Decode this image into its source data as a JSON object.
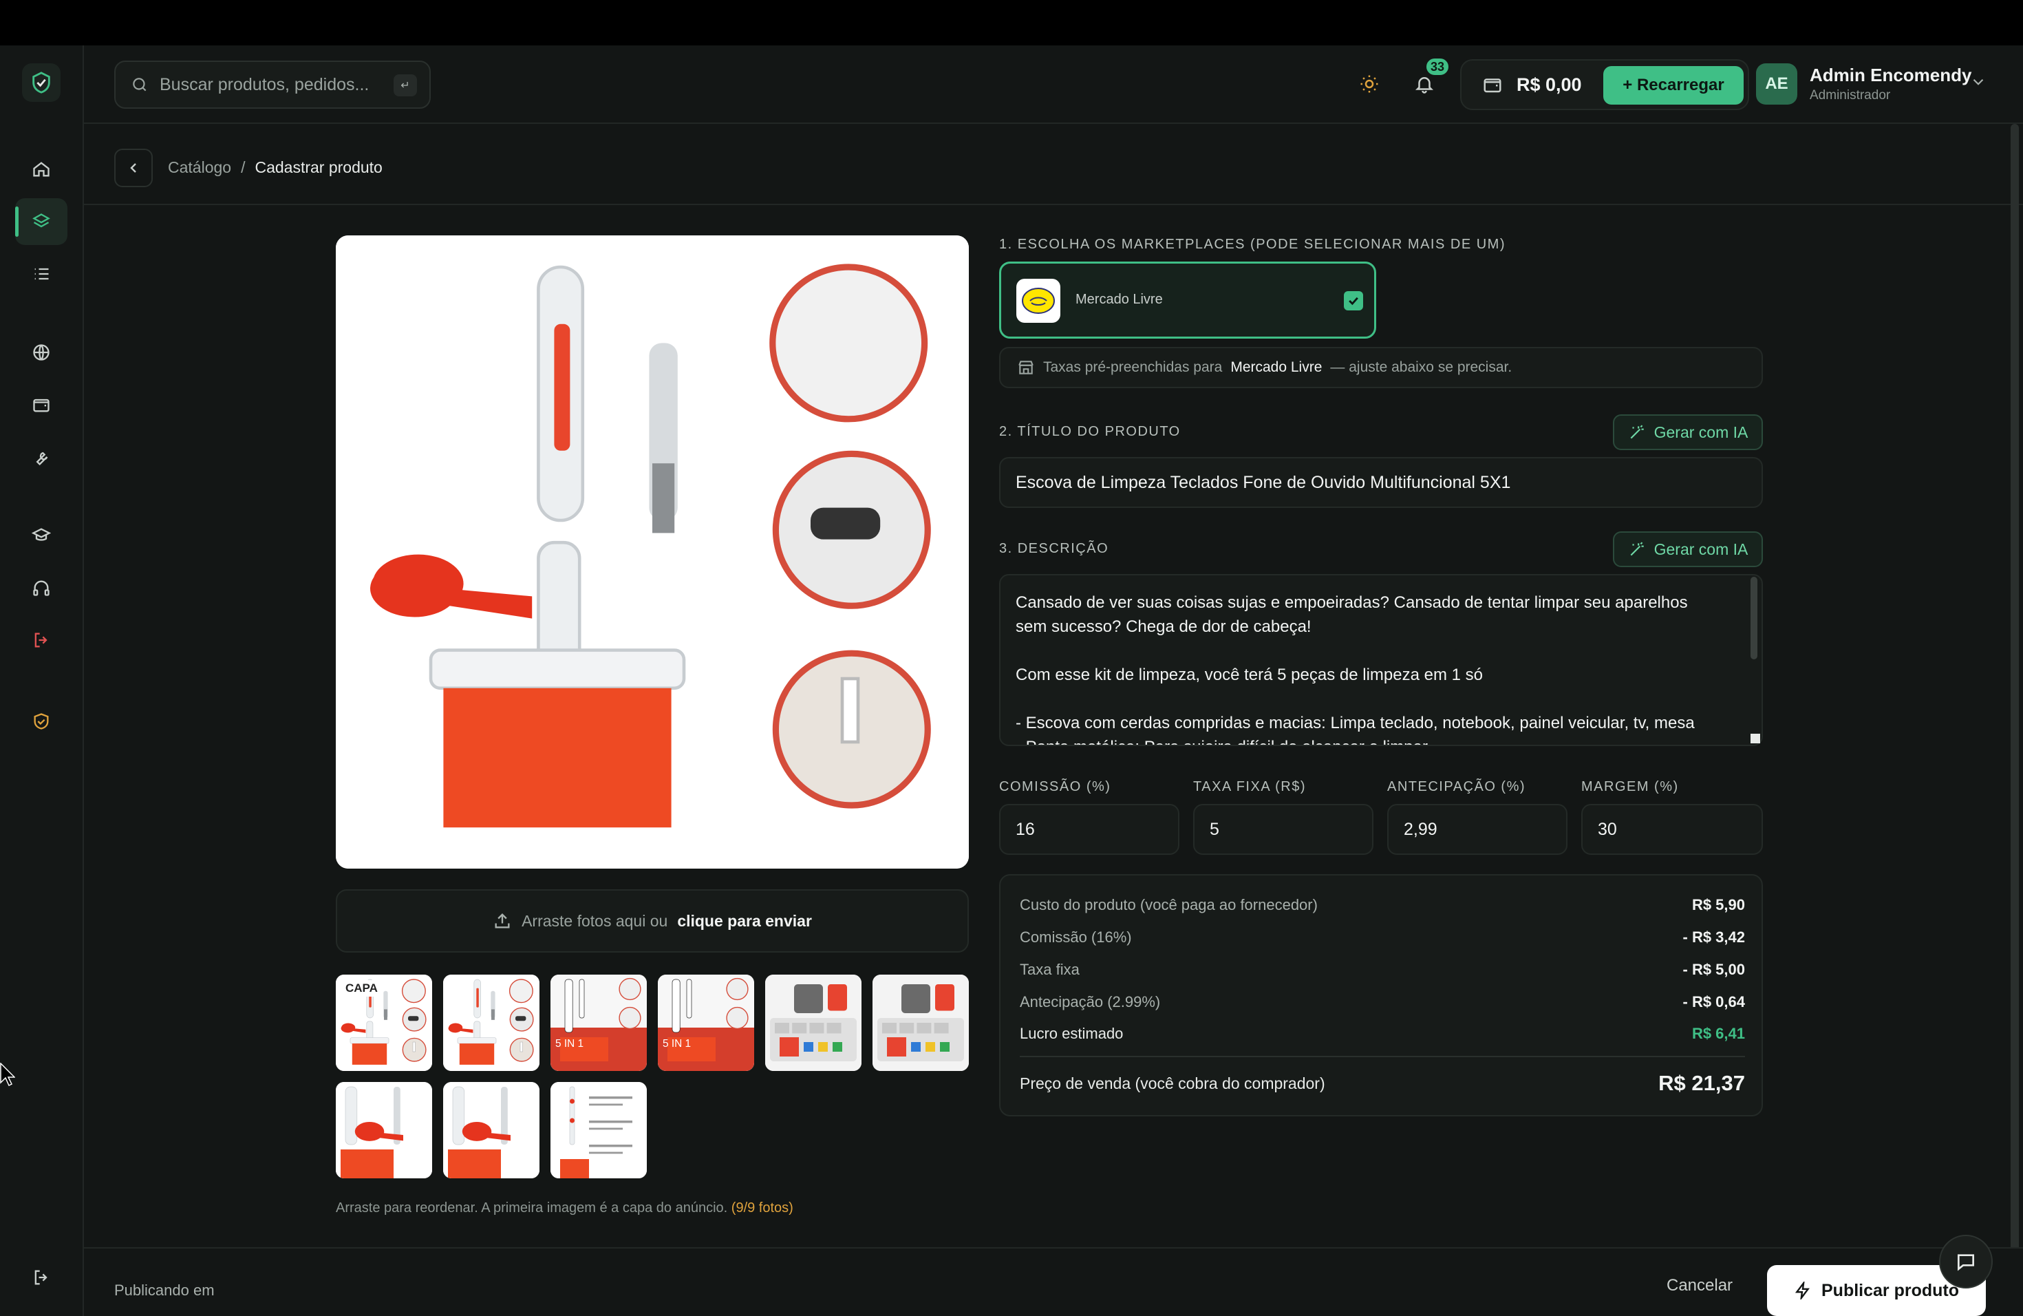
{
  "header": {
    "search_placeholder": "Buscar produtos, pedidos...",
    "search_shortcut": "↵",
    "notifications_count": "33",
    "balance": "R$ 0,00",
    "recharge_label": "Recarregar",
    "user": {
      "initials": "AE",
      "name": "Admin Encomendy",
      "role": "Administrador"
    }
  },
  "sidebar": {
    "items": [
      "home-icon",
      "layers-icon",
      "list-icon",
      "globe-icon",
      "wallet-icon",
      "wrench-icon",
      "graduation-cap-icon",
      "headphones-icon",
      "logout-icon",
      "shield-check-icon"
    ],
    "active": "layers-icon"
  },
  "breadcrumb": {
    "parent": "Catálogo",
    "separator": "/",
    "current": "Cadastrar produto"
  },
  "upload": {
    "dropzone_text": "Arraste fotos aqui ou",
    "dropzone_link": "clique para enviar",
    "cover_badge": "CAPA",
    "hint": "Arraste para reordenar. A primeira imagem é a capa do anúncio.",
    "count": "(9/9 fotos)"
  },
  "form": {
    "marketplaces_label": "1. ESCOLHA OS MARKETPLACES (PODE SELECIONAR MAIS DE UM)",
    "marketplace": {
      "name": "Mercado Livre",
      "selected": true
    },
    "fees_info": {
      "prefix": "Taxas pré-preenchidas para",
      "marketplace": "Mercado Livre",
      "suffix": "— ajuste abaixo se precisar."
    },
    "title_label": "2. TÍTULO DO PRODUTO",
    "ai_button": "Gerar com IA",
    "title_value": "Escova de Limpeza Teclados Fone de Ouvido Multifuncional 5X1",
    "description_label": "3. DESCRIÇÃO",
    "description_value": "Cansado de ver suas coisas sujas e empoeiradas? Cansado de tentar limpar seu aparelhos sem sucesso? Chega de dor de cabeça!\n\nCom esse kit de limpeza, você terá 5 peças de limpeza em 1 só\n\n- Escova com cerdas compridas e macias: Limpa teclado, notebook, painel veicular, tv, mesa\n- Ponta metálica: Para sujeira difícil de alcançar e limpar",
    "fees": {
      "commission_label": "COMISSÃO (%)",
      "commission_value": "16",
      "fixed_label": "TAXA FIXA (R$)",
      "fixed_value": "5",
      "advance_label": "ANTECIPAÇÃO (%)",
      "advance_value": "2,99",
      "margin_label": "MARGEM (%)",
      "margin_value": "30"
    }
  },
  "summary": {
    "rows": [
      {
        "label": "Custo do produto (você paga ao fornecedor)",
        "value": "R$ 5,90"
      },
      {
        "label": "Comissão (16%)",
        "value": "- R$ 3,42"
      },
      {
        "label": "Taxa fixa",
        "value": "- R$ 5,00"
      },
      {
        "label": "Antecipação (2.99%)",
        "value": "- R$ 0,64"
      },
      {
        "label": "Lucro estimado",
        "value": "R$ 6,41"
      }
    ],
    "price_label": "Preço de venda (você cobra do comprador)",
    "price_value": "R$ 21,37"
  },
  "footer": {
    "publishing_in": "Publicando em",
    "cancel_label": "Cancelar",
    "publish_label": "Publicar produto"
  },
  "colors": {
    "accent": "#3fbf86",
    "background": "#131615",
    "warning": "#e0a33d"
  }
}
